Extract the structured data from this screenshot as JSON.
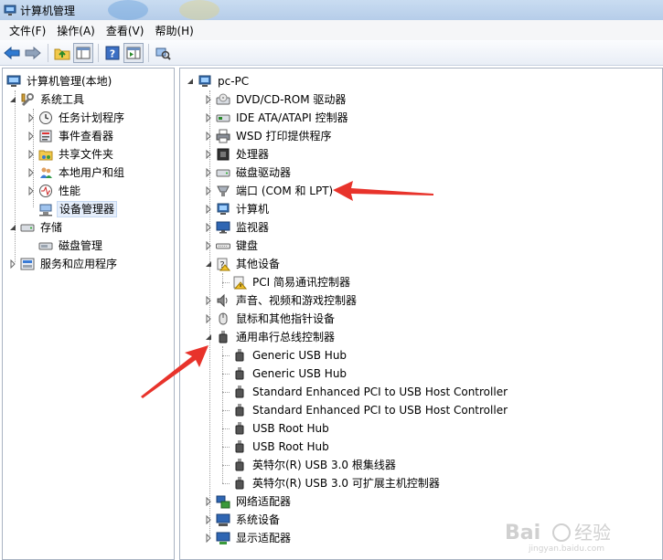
{
  "window": {
    "title": "计算机管理"
  },
  "menu": [
    "文件(F)",
    "操作(A)",
    "查看(V)",
    "帮助(H)"
  ],
  "toolbar": {
    "buttons": [
      "back-icon",
      "forward-icon",
      "up-folder-icon",
      "show-hide-tree-icon",
      "help-icon",
      "action-pane-icon",
      "device-scan-icon"
    ]
  },
  "left_tree": {
    "root": "计算机管理(本地)",
    "system_tools": "系统工具",
    "task_scheduler": "任务计划程序",
    "event_viewer": "事件查看器",
    "shared_folders": "共享文件夹",
    "local_users": "本地用户和组",
    "performance": "性能",
    "device_manager": "设备管理器",
    "storage": "存储",
    "disk_management": "磁盘管理",
    "services_apps": "服务和应用程序"
  },
  "device_tree": {
    "root": "pc-PC",
    "categories": [
      "DVD/CD-ROM 驱动器",
      "IDE ATA/ATAPI 控制器",
      "WSD 打印提供程序",
      "处理器",
      "磁盘驱动器",
      "端口 (COM 和 LPT)",
      "计算机",
      "监视器",
      "键盘",
      "其他设备",
      "声音、视频和游戏控制器",
      "鼠标和其他指针设备",
      "通用串行总线控制器",
      "网络适配器",
      "系统设备",
      "显示适配器"
    ],
    "other_devices_children": [
      "PCI 简易通讯控制器"
    ],
    "usb_children": [
      "Generic USB Hub",
      "Generic USB Hub",
      "Standard Enhanced PCI to USB Host Controller",
      "Standard Enhanced PCI to USB Host Controller",
      "USB Root Hub",
      "USB Root Hub",
      "英特尔(R) USB 3.0 根集线器",
      "英特尔(R) USB 3.0 可扩展主机控制器"
    ]
  },
  "colors": {
    "annotation_arrow": "#e8332b",
    "selection_bg": "#e5eefb",
    "tree_line": "#a0a0a0"
  }
}
